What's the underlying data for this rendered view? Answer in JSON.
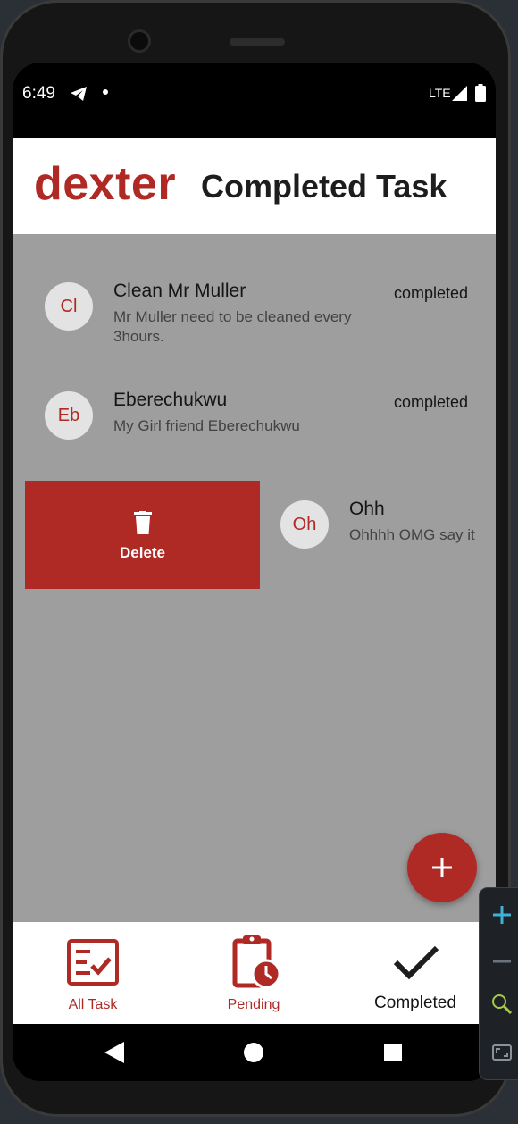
{
  "status_bar": {
    "time": "6:49",
    "network": "LTE",
    "icons": [
      "telegram-icon",
      "notification-dot-icon",
      "signal-icon",
      "battery-icon"
    ]
  },
  "header": {
    "brand": "dexter",
    "title": "Completed Task"
  },
  "tasks": [
    {
      "avatar": "Cl",
      "title": "Clean Mr Muller",
      "description": "Mr Muller need to be cleaned every 3hours.",
      "status": "completed"
    },
    {
      "avatar": "Eb",
      "title": "Eberechukwu",
      "description": "My Girl friend Eberechukwu",
      "status": "completed"
    },
    {
      "avatar": "Oh",
      "title": "Ohh",
      "description": "Ohhhh OMG say it"
    }
  ],
  "swipe_action": {
    "label": "Delete",
    "icon": "trash-icon"
  },
  "fab": {
    "icon": "plus-icon"
  },
  "bottom_nav": {
    "items": [
      {
        "label": "All Task",
        "icon": "checklist-icon"
      },
      {
        "label": "Pending",
        "icon": "clipboard-clock-icon"
      },
      {
        "label": "Completed",
        "icon": "check-icon",
        "active": true
      }
    ]
  },
  "colors": {
    "accent": "#b02a25",
    "list_background": "#9e9e9e",
    "avatar_background": "#e3e3e3"
  }
}
